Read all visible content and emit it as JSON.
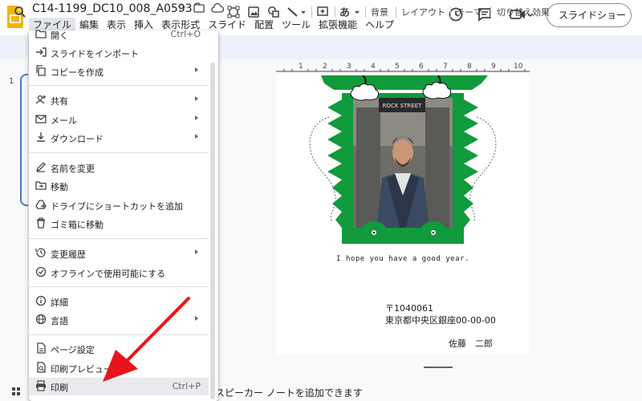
{
  "header": {
    "doc_title": "C14-1199_DC10_008_A0593",
    "menus": [
      "ファイル",
      "編集",
      "表示",
      "挿入",
      "表示形式",
      "スライド",
      "配置",
      "ツール",
      "拡張機能",
      "ヘルプ"
    ],
    "slideshow_label": "スライドショー"
  },
  "toolbar": {
    "background_label": "背景",
    "layout_label": "レイアウト",
    "theme_label": "テーマ",
    "transition_label": "切り替え効果",
    "text_style_glyph": "あ"
  },
  "ruler": [
    "1",
    "2",
    "3",
    "4",
    "5",
    "6",
    "7",
    "8",
    "9",
    "10"
  ],
  "filmstrip": {
    "slide_number": "1"
  },
  "slide": {
    "greeting": "I hope you have a good year.",
    "postal_code": "〒1040061",
    "address": "東京都中央区銀座00-00-00",
    "sender": "佐藤　二郎",
    "photo_sign": "ROCK STREET",
    "colors": {
      "frame_green": "#119a3b",
      "green_dark": "#0e7e30"
    }
  },
  "notes": {
    "text": "スピーカー ノートを追加できます"
  },
  "file_menu": {
    "items": [
      {
        "label": "開く",
        "shortcut": "Ctrl+O",
        "icon": "folder-icon"
      },
      {
        "label": "スライドをインポート",
        "icon": "import-icon"
      },
      {
        "label": "コピーを作成",
        "icon": "copy-icon",
        "submenu": true
      },
      {
        "label": "共有",
        "icon": "person-add-icon",
        "submenu": true
      },
      {
        "label": "メール",
        "icon": "mail-icon",
        "submenu": true
      },
      {
        "label": "ダウンロード",
        "icon": "download-icon",
        "submenu": true
      },
      {
        "label": "名前を変更",
        "icon": "rename-icon"
      },
      {
        "label": "移動",
        "icon": "move-folder-icon"
      },
      {
        "label": "ドライブにショートカットを追加",
        "icon": "drive-shortcut-icon"
      },
      {
        "label": "ゴミ箱に移動",
        "icon": "trash-icon"
      },
      {
        "label": "変更履歴",
        "icon": "history-icon",
        "submenu": true
      },
      {
        "label": "オフラインで使用可能にする",
        "icon": "offline-icon"
      },
      {
        "label": "詳細",
        "icon": "info-icon"
      },
      {
        "label": "言語",
        "icon": "globe-icon",
        "submenu": true
      },
      {
        "label": "ページ設定",
        "icon": "page-setup-icon"
      },
      {
        "label": "印刷プレビュー",
        "icon": "print-preview-icon"
      },
      {
        "label": "印刷",
        "shortcut": "Ctrl+P",
        "icon": "print-icon",
        "hovered": true
      }
    ]
  },
  "colors": {
    "annotation_arrow": "#e8141b",
    "toolbar_bg": "#edf2fa",
    "accent_blue": "#4a79c9"
  }
}
